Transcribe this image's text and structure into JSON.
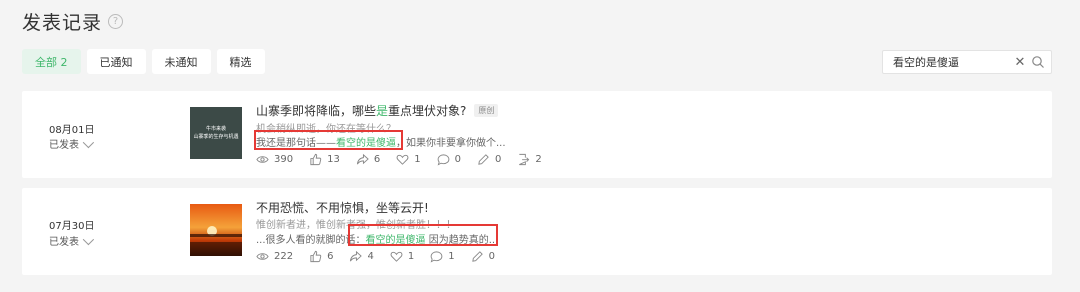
{
  "header": {
    "title": "发表记录",
    "help_glyph": "?"
  },
  "tabs": [
    {
      "label": "全部 2",
      "active": true
    },
    {
      "label": "已通知",
      "active": false
    },
    {
      "label": "未通知",
      "active": false
    },
    {
      "label": "精选",
      "active": false
    }
  ],
  "search": {
    "value": "看空的是傻逼"
  },
  "colors": {
    "accent": "#3fb76b",
    "highlight_box": "#e53935"
  },
  "records": [
    {
      "date": "08月01日",
      "status": "已发表",
      "thumb_lines": [
        "牛市来袭",
        "山寨季的生存与机遇"
      ],
      "title_pre": "山寨季即将降临，哪些",
      "title_hl": "是",
      "title_post": "重点埋伏对象?",
      "badge": "原创",
      "summary": "机会稍纵即逝，你还在等什么？",
      "match_pre": "我还是那句话——",
      "match_hl": "看空的是傻逼",
      "match_post": "，如果你非要拿你做个...",
      "stats": {
        "views": "390",
        "likes": "13",
        "shares": "6",
        "favorites": "1",
        "comments": "0",
        "edits": "0",
        "forwards": "2"
      }
    },
    {
      "date": "07月30日",
      "status": "已发表",
      "title": "不用恐慌、不用惊惧，坐等云开!",
      "summary": "惟创新者进，惟创新者强，惟创新者胜！！！",
      "match_pre": "...很多人看的就脚的话：",
      "match_hl": "看空的是傻逼",
      "match_post": " 因为趋势真的...",
      "stats": {
        "views": "222",
        "likes": "6",
        "shares": "4",
        "favorites": "1",
        "comments": "1",
        "edits": "0"
      }
    }
  ]
}
